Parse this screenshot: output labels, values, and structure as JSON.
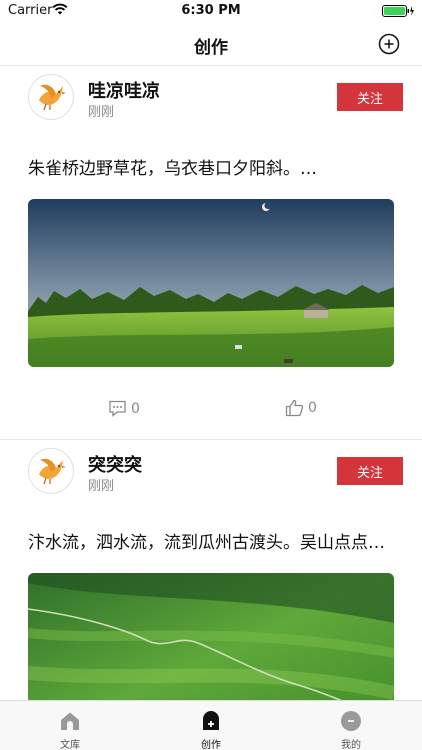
{
  "status_bar": {
    "carrier": "Carrier",
    "time": "6:30 PM"
  },
  "nav": {
    "title": "创作"
  },
  "posts": [
    {
      "name": "哇凉哇凉",
      "time": "刚刚",
      "follow_label": "关注",
      "text": "朱雀桥边野草花，乌衣巷口夕阳斜。…",
      "comments": "0",
      "likes": "0"
    },
    {
      "name": "突突突",
      "time": "刚刚",
      "follow_label": "关注",
      "text": "汴水流，泗水流，流到瓜州古渡头。吴山点点…"
    }
  ],
  "tabbar": {
    "items": [
      {
        "label": "文库"
      },
      {
        "label": "创作"
      },
      {
        "label": "我的"
      }
    ]
  },
  "colors": {
    "accent": "#d3353b",
    "battery": "#3dd45a"
  }
}
